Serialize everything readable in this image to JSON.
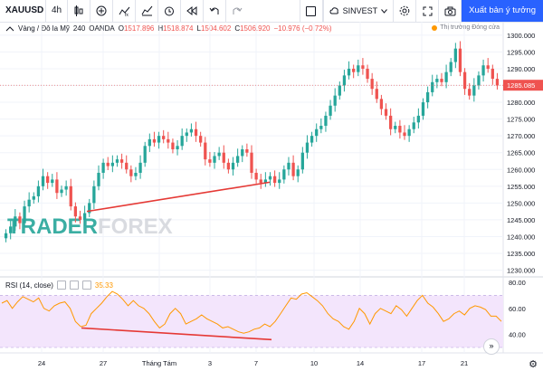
{
  "toolbar": {
    "symbol": "XAUUSD",
    "interval": "4h",
    "broker": "SINVEST",
    "publish_label": "Xuất bản ý tưởng"
  },
  "legend": {
    "title": "Vàng / Đô la Mỹ",
    "interval": "240",
    "exchange": "OANDA",
    "open_label": "O",
    "open": "1517.896",
    "high_label": "H",
    "high": "1518.874",
    "low_label": "L",
    "low": "1504.602",
    "close_label": "C",
    "close": "1506.920",
    "change": "−10.976 (−0.72%)",
    "market_status": "Thị trường Đóng cửa"
  },
  "rsi": {
    "label": "RSI (14, close)",
    "value": "35.33"
  },
  "price_axis": {
    "ticks": [
      "1300.000",
      "1295.000",
      "1290.000",
      "1285.000",
      "1280.000",
      "1275.000",
      "1270.000",
      "1265.000",
      "1260.000",
      "1255.000",
      "1250.000",
      "1245.000",
      "1240.000",
      "1235.000",
      "1230.000"
    ],
    "current_price": "1285.085"
  },
  "rsi_axis": {
    "ticks": [
      "80.00",
      "60.00",
      "40.00"
    ]
  },
  "time_axis": {
    "ticks": [
      "24",
      "27",
      "Tháng Tám",
      "3",
      "7",
      "10",
      "14",
      "17",
      "21"
    ]
  },
  "watermark": {
    "left": "TRADER",
    "right": "FOREX"
  },
  "colors": {
    "up": "#26a69a",
    "down": "#ef5350",
    "rsi_line": "#ff9800",
    "trendline": "#e53935",
    "rsi_band": "#f3e5fc",
    "accent": "#2962ff"
  },
  "chart_data": [
    {
      "type": "candlestick",
      "symbol": "XAUUSD",
      "ylim": [
        1228,
        1304
      ],
      "y_ticks": [
        1230,
        1235,
        1240,
        1245,
        1250,
        1255,
        1260,
        1265,
        1270,
        1275,
        1280,
        1285,
        1290,
        1295,
        1300
      ],
      "close_series": [
        1241,
        1243,
        1246,
        1244,
        1249,
        1251,
        1252,
        1255,
        1258,
        1256,
        1257,
        1253,
        1254,
        1255,
        1249,
        1246,
        1245,
        1247,
        1250,
        1255,
        1259,
        1262,
        1261,
        1262,
        1263,
        1262,
        1260,
        1258,
        1259,
        1262,
        1267,
        1269,
        1268,
        1270,
        1269,
        1268,
        1266,
        1267,
        1270,
        1271,
        1272,
        1270,
        1268,
        1263,
        1262,
        1264,
        1265,
        1262,
        1260,
        1262,
        1264,
        1266,
        1265,
        1259,
        1257,
        1256,
        1257,
        1258,
        1256,
        1257,
        1260,
        1262,
        1258,
        1260,
        1265,
        1268,
        1270,
        1272,
        1273,
        1276,
        1279,
        1282,
        1285,
        1288,
        1290,
        1289,
        1291,
        1290,
        1287,
        1284,
        1281,
        1278,
        1276,
        1272,
        1273,
        1271,
        1270,
        1272,
        1274,
        1276,
        1280,
        1283,
        1286,
        1287,
        1286,
        1289,
        1292,
        1296,
        1289,
        1284,
        1282,
        1285,
        1288,
        1291,
        1290,
        1287,
        1285
      ],
      "last_price": 1285.085
    },
    {
      "type": "line",
      "name": "RSI (14, close)",
      "ylim": [
        30,
        80
      ],
      "y_ticks": [
        40,
        60,
        80
      ],
      "band": [
        30,
        70
      ],
      "values": [
        64,
        66,
        60,
        65,
        69,
        67,
        65,
        68,
        60,
        58,
        62,
        64,
        65,
        60,
        50,
        46,
        47,
        56,
        60,
        64,
        69,
        73,
        71,
        67,
        62,
        66,
        62,
        60,
        56,
        50,
        45,
        48,
        56,
        60,
        56,
        48,
        50,
        52,
        55,
        52,
        50,
        48,
        45,
        46,
        44,
        42,
        41,
        42,
        44,
        45,
        48,
        46,
        50,
        56,
        62,
        68,
        67,
        71,
        72,
        69,
        66,
        62,
        56,
        52,
        50,
        46,
        44,
        50,
        60,
        56,
        48,
        56,
        60,
        58,
        56,
        62,
        59,
        54,
        60,
        66,
        70,
        64,
        61,
        56,
        50,
        52,
        56,
        58,
        55,
        60,
        62,
        61,
        59,
        54,
        54,
        50
      ],
      "last_value": 35.33
    }
  ],
  "annotations": {
    "price_trendline": {
      "from": [
        1247.5,
        "Jul 25"
      ],
      "to": [
        1256,
        "Aug 7"
      ]
    },
    "rsi_trendline": {
      "from": 45,
      "to": 36
    }
  }
}
